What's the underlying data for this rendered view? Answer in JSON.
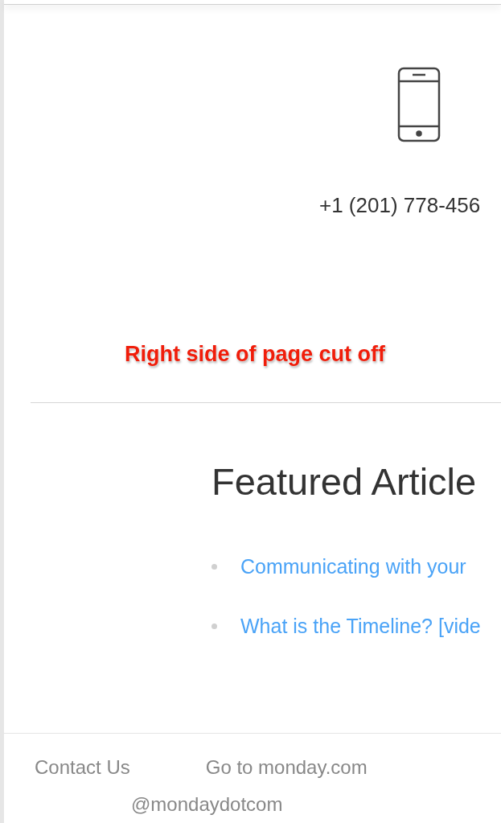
{
  "contact": {
    "phone": "+1 (201) 778-456"
  },
  "annotation": "Right side of page cut off",
  "featured": {
    "heading": "Featured Article",
    "articles": [
      "Communicating with your",
      "What is the Timeline? [vide"
    ]
  },
  "footer": {
    "links": [
      "Contact Us",
      "Go to monday.com"
    ],
    "handle": "@mondaydotcom"
  }
}
